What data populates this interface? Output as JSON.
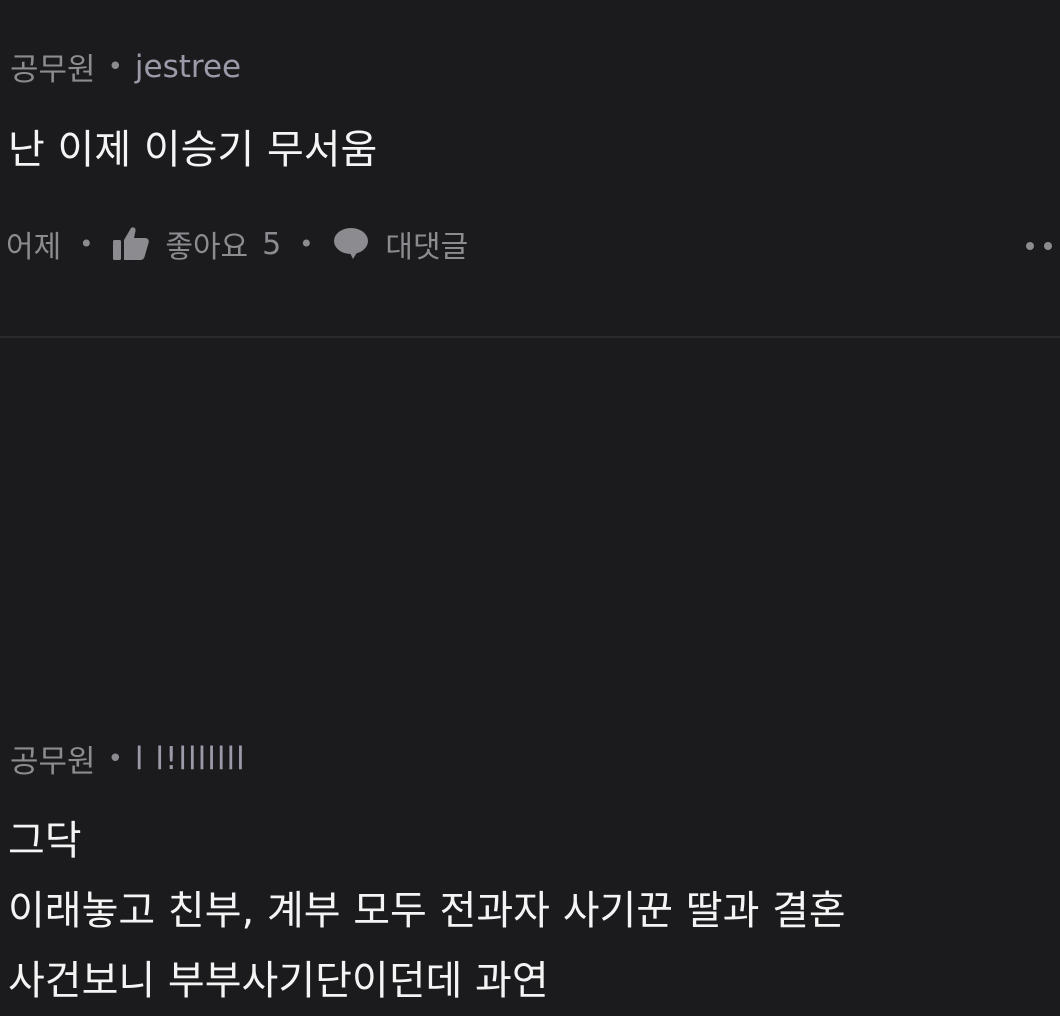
{
  "comment1": {
    "author_role": "공무원",
    "username": "jestree",
    "text": "난 이제 이승기 무서움",
    "time": "어제",
    "like_label": "좋아요",
    "like_count": "5",
    "reply_label": "대댓글",
    "icons": {
      "like": "thumbs-up-icon",
      "reply": "speech-bubble-icon",
      "more": "more-dots-icon"
    }
  },
  "comment2": {
    "author_role": "공무원",
    "username": "l l!lllllll",
    "lines": [
      "그닥",
      "이래놓고 친부, 계부 모두 전과자 사기꾼 딸과 결혼",
      "사건보니 부부사기단이던데 과연"
    ]
  },
  "colors": {
    "background": "#1b1b1d",
    "text": "#f4f4f4",
    "muted": "#8c8c90"
  }
}
